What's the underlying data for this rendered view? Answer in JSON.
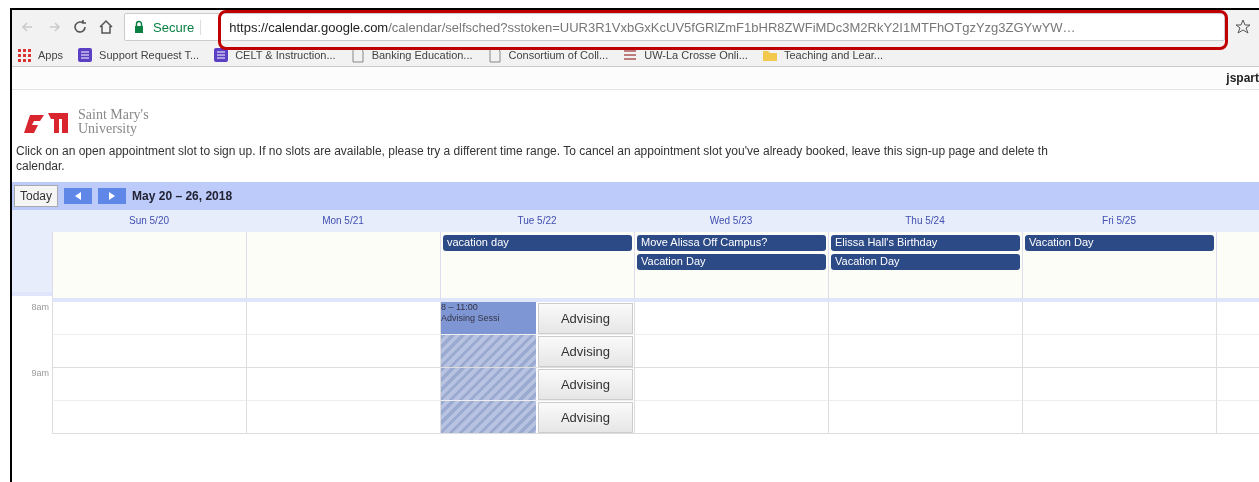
{
  "browser": {
    "secure_label": "Secure",
    "url_host": "https://calendar.google.com",
    "url_path": "/calendar/selfsched?sstoken=UUR3R1VxbGxKcUV5fGRlZmF1bHR8ZWFiMDc3M2RkY2I1MTFhOTgzYzg3ZGYwYW…",
    "highlighted": true,
    "bookmarks": [
      {
        "label": "Apps",
        "kind": "apps"
      },
      {
        "label": "Support Request T...",
        "kind": "form"
      },
      {
        "label": "CELT & Instruction...",
        "kind": "form"
      },
      {
        "label": "Banking Education...",
        "kind": "page"
      },
      {
        "label": "Consortium of Coll...",
        "kind": "page"
      },
      {
        "label": "UW-La Crosse Onli...",
        "kind": "list"
      },
      {
        "label": "Teaching and Lear...",
        "kind": "folder"
      }
    ]
  },
  "user": "jspart",
  "logo": {
    "line1": "Saint Mary's",
    "line2": "University"
  },
  "notice": [
    "Click on an open appointment slot to sign up. If no slots are available, please try a different time range. To cancel an appointment slot you've already booked, leave this sign-up page and delete th",
    "calendar."
  ],
  "toolbar": {
    "today": "Today",
    "range": "May 20 – 26, 2018"
  },
  "days": [
    {
      "label": "Sun 5/20"
    },
    {
      "label": "Mon 5/21"
    },
    {
      "label": "Tue 5/22",
      "all_day": [
        "vacation day"
      ],
      "busy": {
        "time": "8 – 11:00",
        "title": "Advising Sessi"
      }
    },
    {
      "label": "Wed 5/23",
      "all_day": [
        "Move Alissa Off Campus?",
        "Vacation Day"
      ]
    },
    {
      "label": "Thu 5/24",
      "all_day": [
        "Elissa Hall's Birthday",
        "Vacation Day"
      ]
    },
    {
      "label": "Fri 5/25",
      "all_day": [
        "Vacation Day"
      ]
    }
  ],
  "rows": [
    {
      "time": "8am",
      "slot": "Advising"
    },
    {
      "slot": "Advising"
    },
    {
      "time": "9am",
      "slot": "Advising"
    },
    {
      "slot": "Advising"
    }
  ]
}
